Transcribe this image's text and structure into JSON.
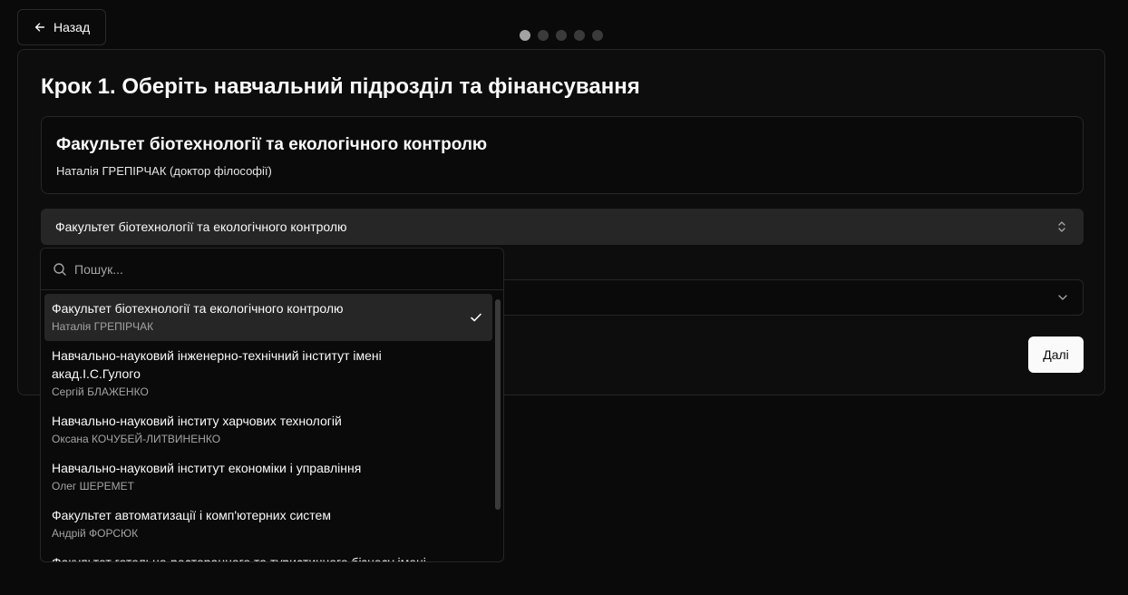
{
  "nav": {
    "back_label": "Назад"
  },
  "progress": {
    "total_steps": 5,
    "current_step": 1
  },
  "step": {
    "title": "Крок 1. Оберіть навчальний підрозділ та фінансування"
  },
  "selected_unit": {
    "title": "Факультет біотехнології та екологічного контролю",
    "subtitle": "Наталія ГРЕПІРЧАК (доктор філософії)"
  },
  "unit_select": {
    "value": "Факультет біотехнології та екологічного контролю"
  },
  "dropdown": {
    "search_placeholder": "Пошук...",
    "options": [
      {
        "name": "Факультет біотехнології та екологічного контролю",
        "person": "Наталія ГРЕПІРЧАК",
        "selected": true
      },
      {
        "name": "Навчально-науковий інженерно-технічний інститут імені акад.І.С.Гулого",
        "person": "Сергій БЛАЖЕНКО",
        "selected": false
      },
      {
        "name": "Навчально-науковий інститу харчових технологій",
        "person": "Оксана КОЧУБЕЙ-ЛИТВИНЕНКО",
        "selected": false
      },
      {
        "name": "Навчально-науковий інститут економіки і управління",
        "person": "Олег ШЕРЕМЕТ",
        "selected": false
      },
      {
        "name": "Факультет автоматизації і комп'ютерних систем",
        "person": "Андрій ФОРСЮК",
        "selected": false
      },
      {
        "name": "Факультет готельно-ресторанного та туристичного бізнесу імені",
        "person": "",
        "selected": false
      }
    ]
  },
  "next_button": {
    "label": "Далі"
  }
}
